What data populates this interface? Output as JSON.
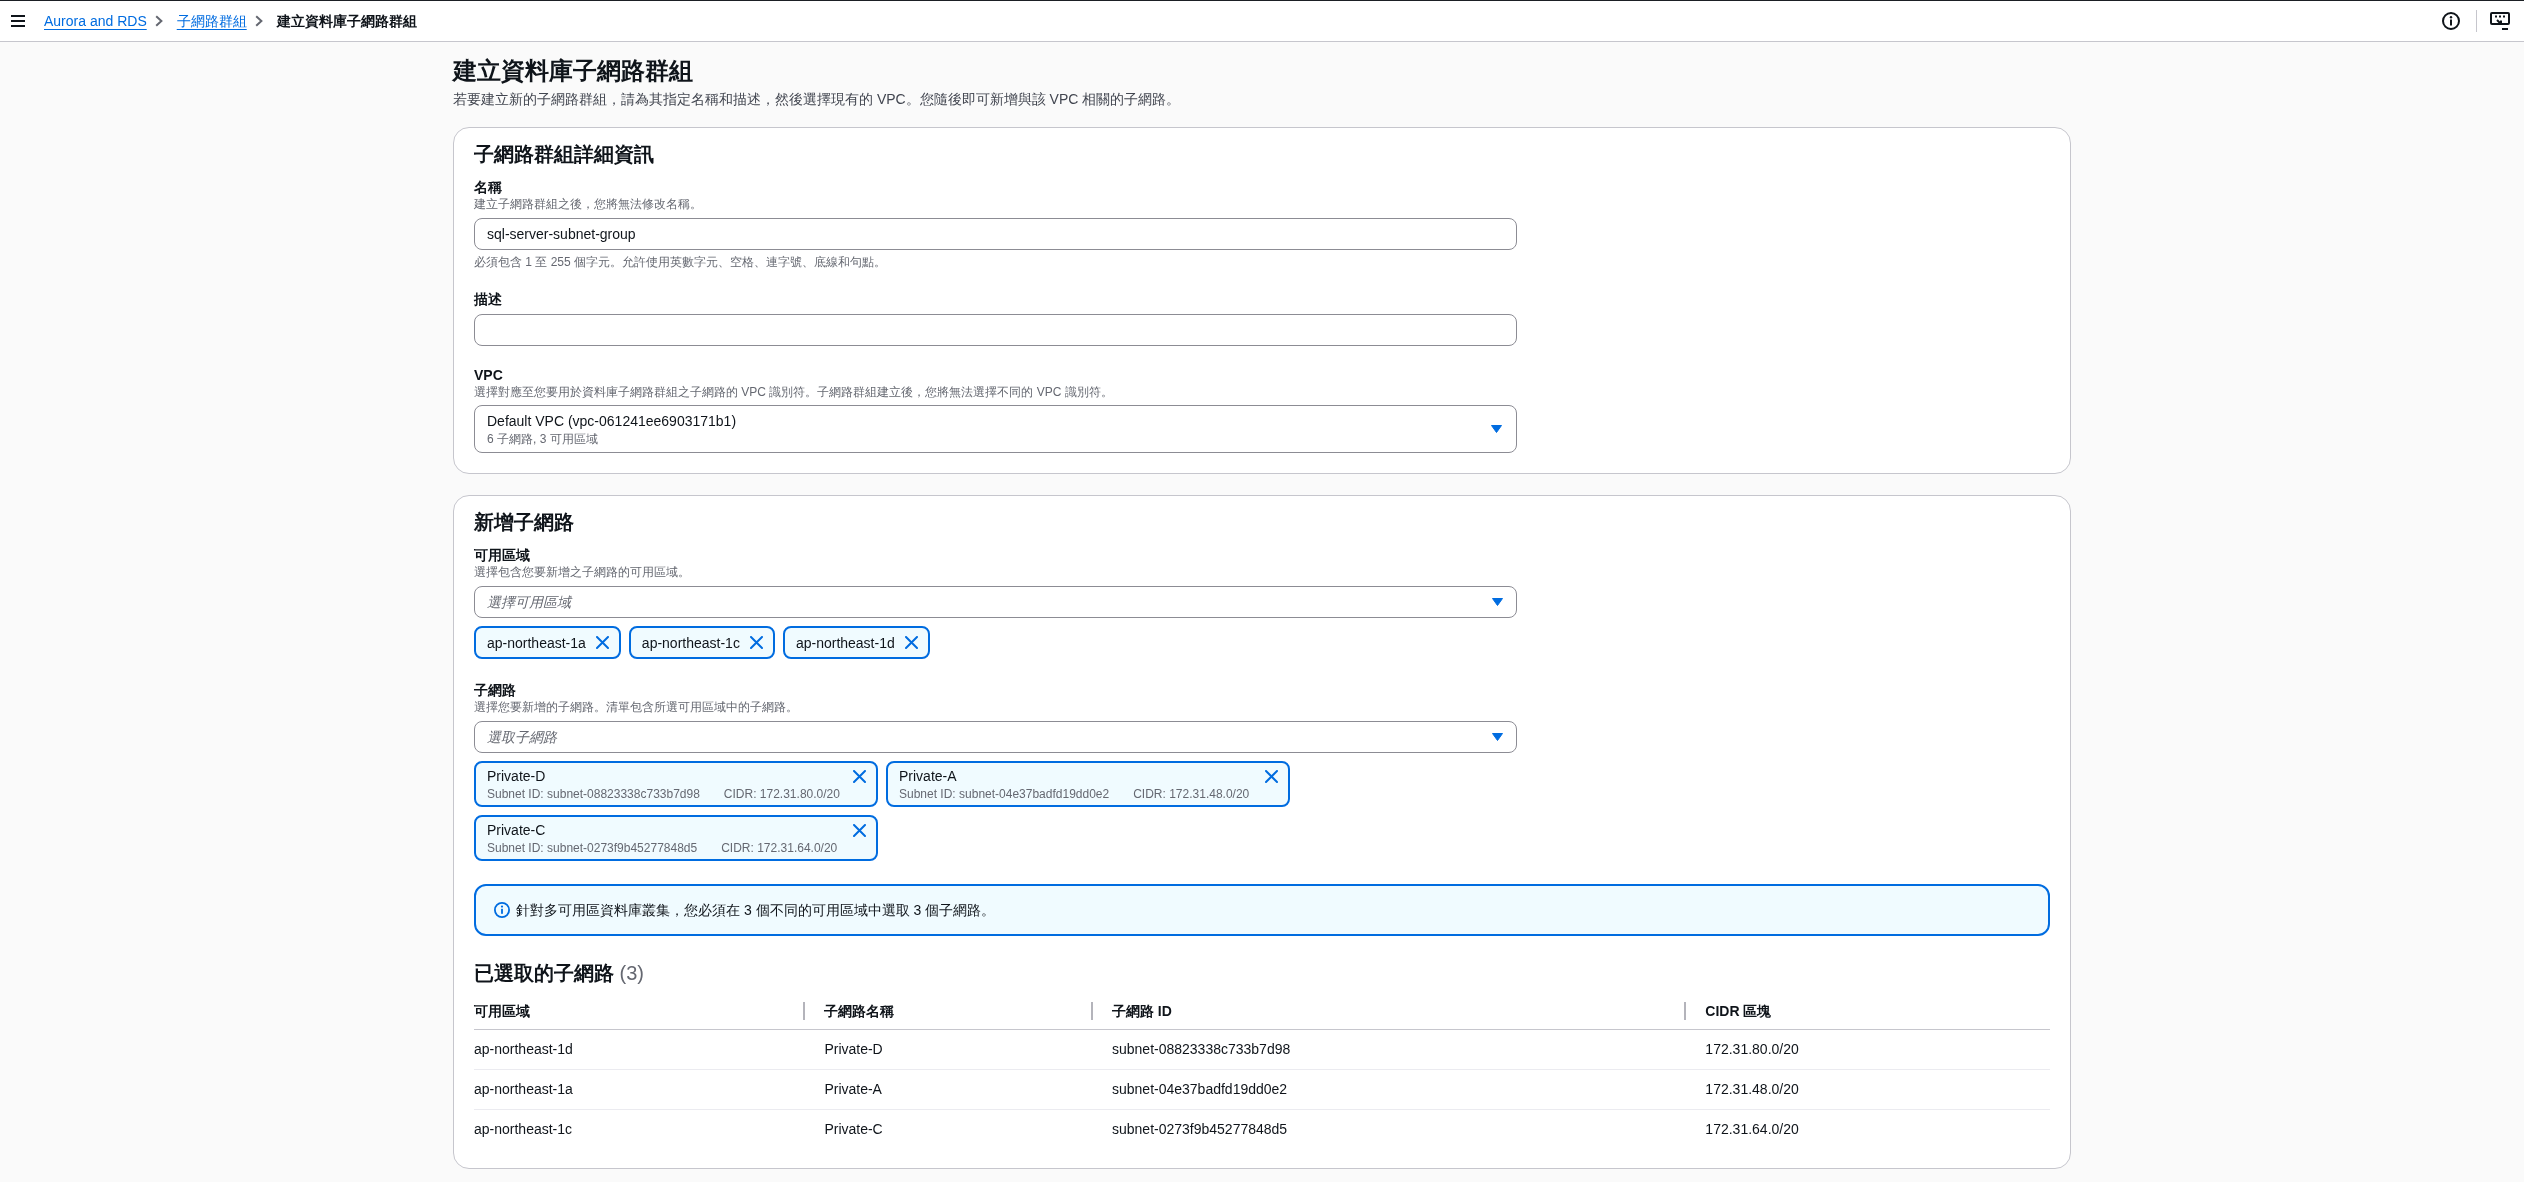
{
  "top_nav": {
    "breadcrumbs": [
      {
        "label": "Aurora and RDS",
        "kind": "link"
      },
      {
        "label": "子網路群組",
        "kind": "link"
      },
      {
        "label": "建立資料庫子網路群組",
        "kind": "current"
      }
    ]
  },
  "page_header": {
    "title": "建立資料庫子網路群組",
    "description": "若要建立新的子網路群組，請為其指定名稱和描述，然後選擇現有的 VPC。您隨後即可新增與該 VPC 相關的子網路。"
  },
  "subnet_group_details": {
    "title": "子網路群組詳細資訊",
    "fields": [
      {
        "kind": "input",
        "label": "名稱",
        "description": "建立子網路群組之後，您將無法修改名稱。",
        "value": "sql-server-subnet-group",
        "constraint": "必須包含 1 至 255 個字元。允許使用英數字元、空格、連字號、底線和句點。"
      },
      {
        "kind": "input",
        "label": "描述"
      },
      {
        "kind": "select",
        "label": "VPC",
        "description": "選擇對應至您要用於資料庫子網路群組之子網路的 VPC 識別符。子網路群組建立後，您將無法選擇不同的 VPC 識別符。",
        "value": "Default VPC (vpc-061241ee6903171b1)",
        "value_detail": "6 子網路, 3 可用區域"
      }
    ]
  },
  "add_subnets": {
    "title": "新增子網路",
    "fields": [
      {
        "kind": "multiselect",
        "label": "可用區域",
        "description": "選擇包含您要新增之子網路的可用區域。",
        "placeholder": "選擇可用區域",
        "tokens": [
          {
            "label": "ap-northeast-1a"
          },
          {
            "label": "ap-northeast-1c"
          },
          {
            "label": "ap-northeast-1d"
          }
        ]
      },
      {
        "kind": "multiselect",
        "label": "子網路",
        "description": "選擇您要新增的子網路。清單包含所選可用區域中的子網路。",
        "placeholder": "選取子網路",
        "tokens": [
          {
            "label": "Private-D",
            "subnet_id": "Subnet ID: subnet-08823338c733b7d98",
            "cidr": "CIDR: 172.31.80.0/20"
          },
          {
            "label": "Private-A",
            "subnet_id": "Subnet ID: subnet-04e37badfd19dd0e2",
            "cidr": "CIDR: 172.31.48.0/20"
          },
          {
            "label": "Private-C",
            "subnet_id": "Subnet ID: subnet-0273f9b45277848d5",
            "cidr": "CIDR: 172.31.64.0/20"
          }
        ]
      }
    ],
    "alert": {
      "kind": "info",
      "text": "針對多可用區資料庫叢集，您必須在 3 個不同的可用區域中選取 3 個子網路。"
    },
    "selected_subnets": {
      "title": "已選取的子網路",
      "count": "(3)",
      "columns": [
        "可用區域",
        "子網路名稱",
        "子網路 ID",
        "CIDR 區塊"
      ],
      "rows": [
        [
          "ap-northeast-1d",
          "Private-D",
          "subnet-08823338c733b7d98",
          "172.31.80.0/20"
        ],
        [
          "ap-northeast-1a",
          "Private-A",
          "subnet-04e37badfd19dd0e2",
          "172.31.48.0/20"
        ],
        [
          "ap-northeast-1c",
          "Private-C",
          "subnet-0273f9b45277848d5",
          "172.31.64.0/20"
        ]
      ]
    }
  }
}
